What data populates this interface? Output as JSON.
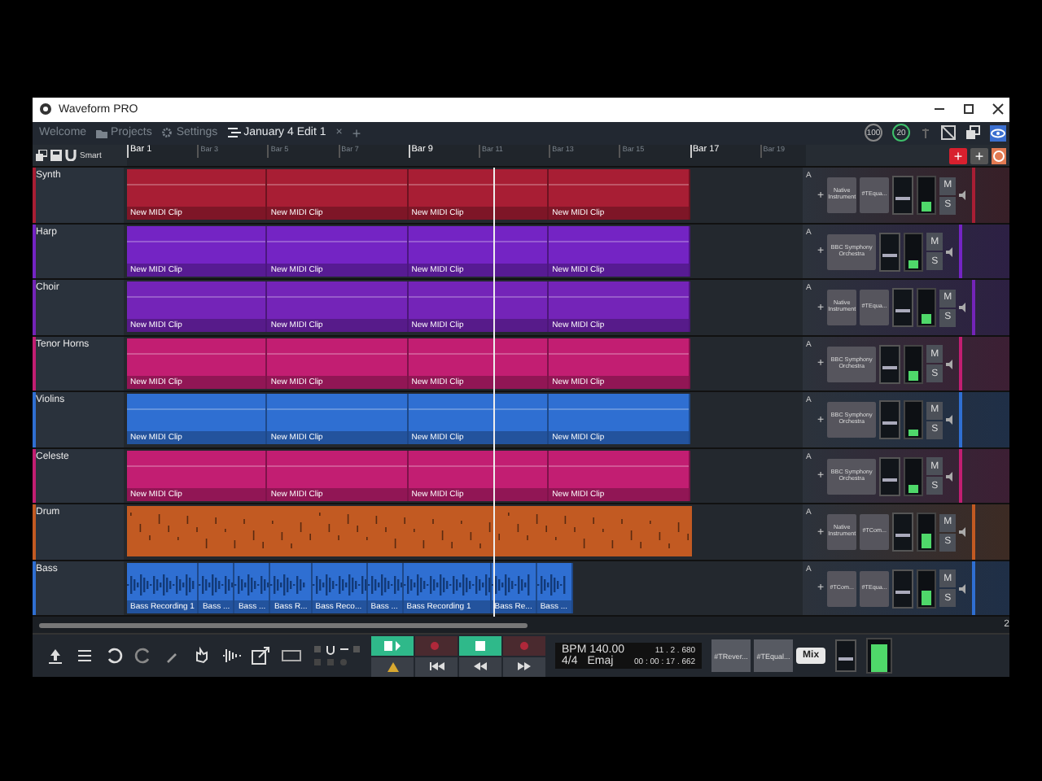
{
  "window": {
    "title": "Waveform PRO"
  },
  "tabs": [
    {
      "label": "Welcome",
      "selected": false
    },
    {
      "label": "Projects",
      "selected": false
    },
    {
      "label": "Settings",
      "selected": false
    },
    {
      "label": "January 4 Edit 1",
      "selected": true
    }
  ],
  "tab_close": "×",
  "tab_add": "+",
  "header_meters": [
    "100",
    "20"
  ],
  "edit_mode": "Smart",
  "add_plugin": "+",
  "ruler": [
    {
      "label": "Bar 1",
      "major": true
    },
    {
      "label": "Bar 3",
      "major": false
    },
    {
      "label": "Bar 5",
      "major": false
    },
    {
      "label": "Bar 7",
      "major": false
    },
    {
      "label": "Bar 9",
      "major": true
    },
    {
      "label": "Bar 11",
      "major": false
    },
    {
      "label": "Bar 13",
      "major": false
    },
    {
      "label": "Bar 15",
      "major": false
    },
    {
      "label": "Bar 17",
      "major": true
    },
    {
      "label": "Bar 19",
      "major": false
    }
  ],
  "tracks": [
    {
      "name": "Synth",
      "color": "#a81e34",
      "kind": "midi",
      "clips": [
        "New MIDI Clip",
        "New MIDI Clip",
        "New MIDI Clip",
        "New MIDI Clip"
      ],
      "plugins": [
        "Native Instrument",
        "#TEqua..."
      ],
      "fader": {
        "level": 0.45
      },
      "meter": {
        "level": 0.3
      },
      "automation": "A",
      "mute": "M",
      "solo": "S"
    },
    {
      "name": "Harp",
      "color": "#7424c4",
      "kind": "midi",
      "clips": [
        "New MIDI Clip",
        "New MIDI Clip",
        "New MIDI Clip",
        "New MIDI Clip"
      ],
      "plugins": [
        "BBC Symphony Orchestra"
      ],
      "fader": {
        "level": 0.45
      },
      "meter": {
        "level": 0.25
      },
      "automation": "A",
      "mute": "M",
      "solo": "S"
    },
    {
      "name": "Choir",
      "color": "#7424b8",
      "kind": "midi",
      "clips": [
        "New MIDI Clip",
        "New MIDI Clip",
        "New MIDI Clip",
        "New MIDI Clip"
      ],
      "plugins": [
        "Native Instrument",
        "#TEqua..."
      ],
      "fader": {
        "level": 0.45
      },
      "meter": {
        "level": 0.3
      },
      "automation": "A",
      "mute": "M",
      "solo": "S"
    },
    {
      "name": "Tenor Horns",
      "color": "#c21e72",
      "kind": "midi",
      "clips": [
        "New MIDI Clip",
        "New MIDI Clip",
        "New MIDI Clip",
        "New MIDI Clip"
      ],
      "plugins": [
        "BBC Symphony Orchestra"
      ],
      "fader": {
        "level": 0.45
      },
      "meter": {
        "level": 0.3
      },
      "automation": "A",
      "mute": "M",
      "solo": "S"
    },
    {
      "name": "Violins",
      "color": "#2f6fd2",
      "kind": "midi",
      "clips": [
        "New MIDI Clip",
        "New MIDI Clip",
        "New MIDI Clip",
        "New MIDI Clip"
      ],
      "plugins": [
        "BBC Symphony Orchestra"
      ],
      "fader": {
        "level": 0.45
      },
      "meter": {
        "level": 0.2
      },
      "automation": "A",
      "mute": "M",
      "solo": "S"
    },
    {
      "name": "Celeste",
      "color": "#c21e72",
      "kind": "midi",
      "clips": [
        "New MIDI Clip",
        "New MIDI Clip",
        "New MIDI Clip",
        "New MIDI Clip"
      ],
      "plugins": [
        "BBC Symphony Orchestra"
      ],
      "fader": {
        "level": 0.45
      },
      "meter": {
        "level": 0.25
      },
      "automation": "A",
      "mute": "M",
      "solo": "S"
    },
    {
      "name": "Drum",
      "color": "#c25a22",
      "kind": "drum",
      "plugins": [
        "Native Instrument",
        "#TCom..."
      ],
      "fader": {
        "level": 0.45
      },
      "meter": {
        "level": 0.45
      },
      "automation": "A",
      "mute": "M",
      "solo": "S"
    },
    {
      "name": "Bass",
      "color": "#2f6fd2",
      "kind": "audio",
      "clips": [
        "Bass Recording 1",
        "Bass ...",
        "Bass ...",
        "Bass R...",
        "Bass Reco...",
        "Bass ...",
        "Bass Recording 1",
        "Bass Re...",
        "Bass ..."
      ],
      "plugins": [
        "#TCom...",
        "#TEqua..."
      ],
      "fader": {
        "level": 0.45
      },
      "meter": {
        "level": 0.45
      },
      "automation": "A",
      "mute": "M",
      "solo": "S"
    }
  ],
  "pager": {
    "current": "2"
  },
  "transport": {
    "bpm": "BPM 140.00",
    "time_sig": "4/4",
    "key": "Emaj",
    "position": "11 . 2 . 680",
    "time": "00 : 00 : 17 . 662"
  },
  "master_plugins": [
    "#TRever...",
    "#TEqual...",
    "Mix"
  ],
  "master_fader": {
    "level": 0.45
  },
  "master_meter": {
    "level": 0.85
  }
}
